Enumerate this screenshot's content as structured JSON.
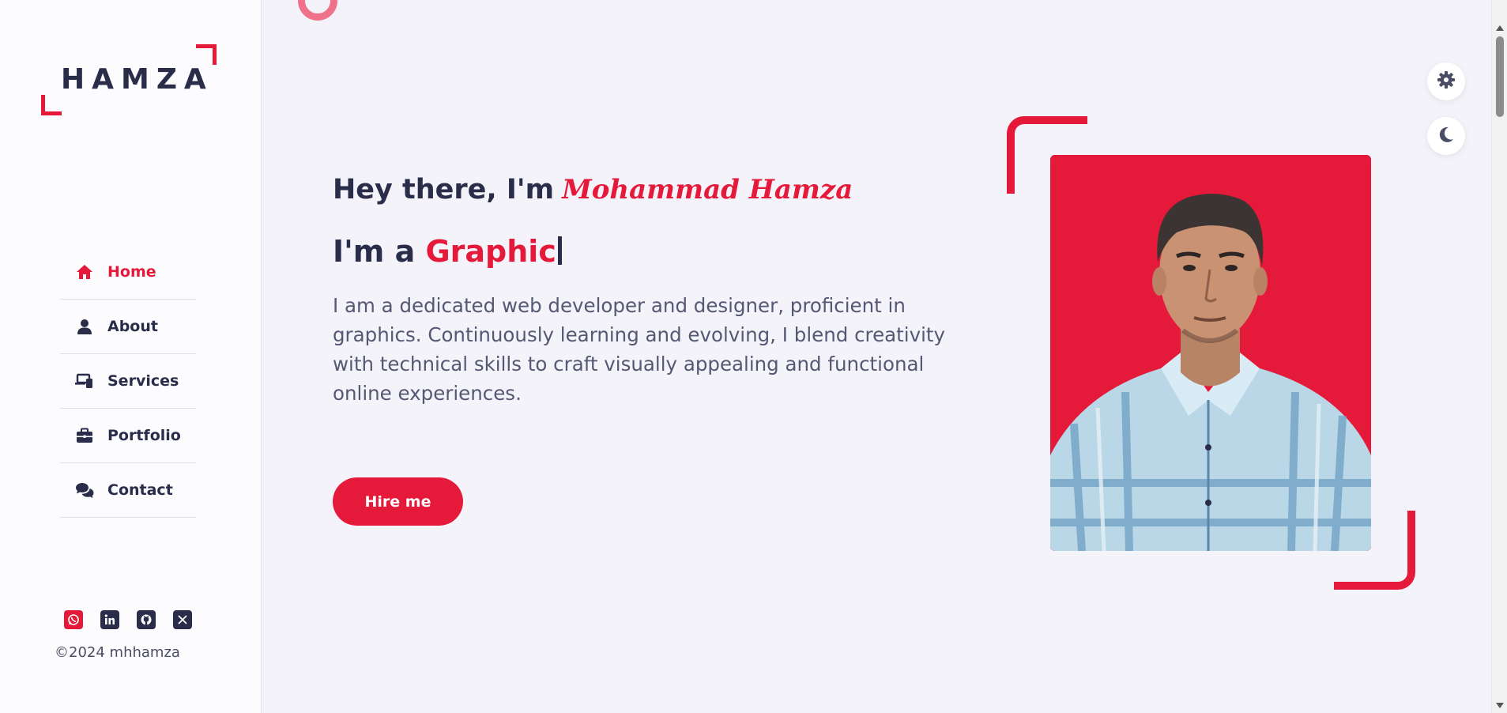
{
  "brand": {
    "logo_text": "HAMZA"
  },
  "nav": {
    "items": [
      {
        "label": "Home",
        "icon": "home-icon",
        "active": true
      },
      {
        "label": "About",
        "icon": "user-icon",
        "active": false
      },
      {
        "label": "Services",
        "icon": "devices-icon",
        "active": false
      },
      {
        "label": "Portfolio",
        "icon": "briefcase-icon",
        "active": false
      },
      {
        "label": "Contact",
        "icon": "chat-icon",
        "active": false
      }
    ]
  },
  "socials": [
    "whatsapp-icon",
    "linkedin-icon",
    "github-icon",
    "x-twitter-icon"
  ],
  "footer": {
    "copyright": "©2024 mhhamza"
  },
  "hero": {
    "greeting": "Hey there, I'm",
    "name": "Mohammad  Hamza",
    "role_prefix": "I'm a",
    "role_word": "Graphic",
    "bio": "I am a dedicated web developer and designer, proficient in graphics. Continuously learning and evolving, I blend creativity with technical skills to craft visually appealing and functional online experiences.",
    "cta_label": "Hire me"
  },
  "colors": {
    "accent": "#e5193a",
    "text": "#2a2d4a",
    "background": "#f3f3f9",
    "sidebar": "#fcfbfe"
  }
}
